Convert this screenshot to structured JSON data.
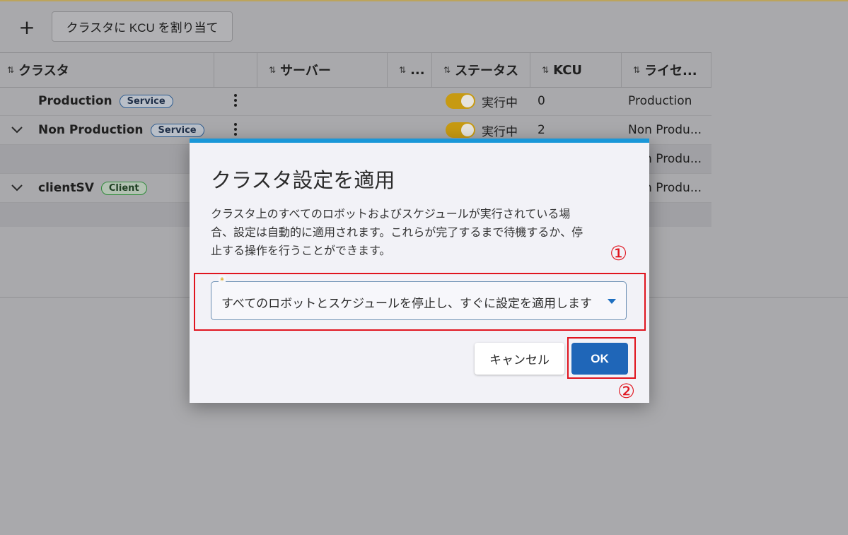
{
  "toolbar": {
    "add_icon_glyph": "+",
    "assign_label": "クラスタに KCU を割り当て"
  },
  "table": {
    "columns": [
      {
        "label": "クラスタ"
      },
      {
        "label": ""
      },
      {
        "label": "サーバー"
      },
      {
        "label": "..."
      },
      {
        "label": "ステータス"
      },
      {
        "label": "KCU"
      },
      {
        "label": "ライセ..."
      }
    ],
    "sort_glyph": "⇅",
    "rows": [
      {
        "name": "Production",
        "badge": "Service",
        "status": "実行中",
        "kcu": "0",
        "license": "Production"
      },
      {
        "name": "Non Production",
        "badge": "Service",
        "status": "実行中",
        "kcu": "2",
        "license": "Non Produ..."
      },
      {
        "license": "Non Produ..."
      },
      {
        "name": "clientSV",
        "badge": "Client",
        "license": "Non Produ..."
      }
    ]
  },
  "dialog": {
    "title": "クラスタ設定を適用",
    "description": "クラスタ上のすべてのロボットおよびスケジュールが実行されている場合、設定は自動的に適用されます。これらが完了するまで待機するか、停止する操作を行うことができます。",
    "required_mark": "*",
    "select_value": "すべてのロボットとスケジュールを停止し、すぐに設定を適用します",
    "cancel_label": "キャンセル",
    "ok_label": "OK"
  },
  "annotations": {
    "step1": "①",
    "step2": "②"
  },
  "colors": {
    "accent": "#1a97d8",
    "ok": "#1f66b8",
    "annotation": "#e0151f",
    "toggle": "#c79a12"
  }
}
